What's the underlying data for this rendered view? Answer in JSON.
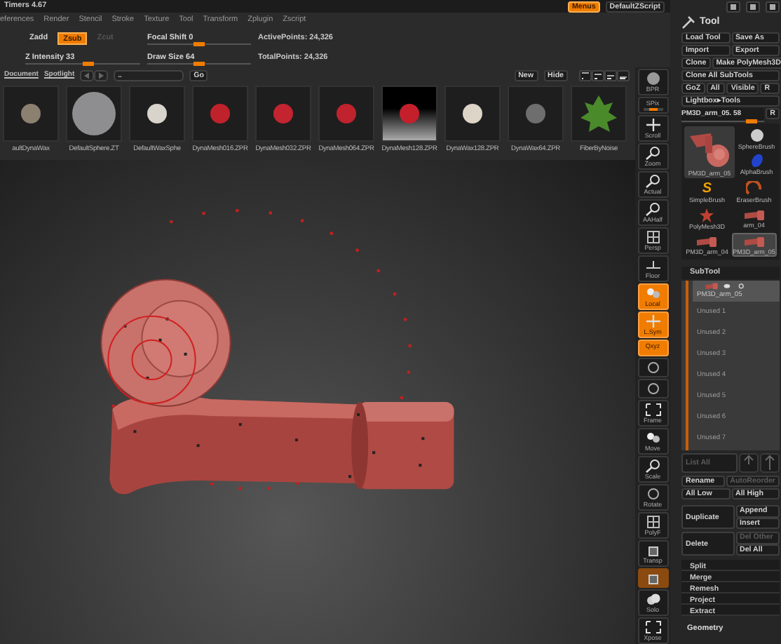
{
  "window": {
    "title": "Timers 4.67"
  },
  "menu": [
    "eferences",
    "Render",
    "Stencil",
    "Stroke",
    "Texture",
    "Tool",
    "Transform",
    "Zplugin",
    "Zscript"
  ],
  "header_buttons": [
    {
      "label": "Menus",
      "on": true
    },
    {
      "label": "DefaultZScript",
      "on": false
    }
  ],
  "shelf": {
    "modes": [
      {
        "label": "Zadd",
        "selected": false,
        "disabled": false
      },
      {
        "label": "Zsub",
        "selected": true,
        "disabled": false
      },
      {
        "label": "Zcut",
        "selected": false,
        "disabled": true
      }
    ],
    "sliders": [
      {
        "label": "Focal Shift 0",
        "level": 0.5
      },
      {
        "label": "Z Intensity 33",
        "level": 0.55
      },
      {
        "label": "Draw Size 64",
        "level": 0.5
      }
    ],
    "stats": [
      "ActivePoints: 24,326",
      "TotalPoints: 24,326"
    ]
  },
  "lightbox": {
    "tabs": [
      "Document",
      "Spotlight"
    ],
    "path": "..",
    "go": "Go",
    "actions": [
      "New",
      "Hide"
    ],
    "items": [
      {
        "label": "aultDynaWax",
        "kind": "sphere",
        "color": "#8c8070"
      },
      {
        "label": "DefaultSphere.ZT",
        "kind": "sphere-large",
        "color": "#8e8e90"
      },
      {
        "label": "DefaultWaxSphe",
        "kind": "sphere",
        "color": "#d8d4cc"
      },
      {
        "label": "DynaMesh016.ZPR",
        "kind": "sphere",
        "color": "#c0222c"
      },
      {
        "label": "DynaMesh032.ZPR",
        "kind": "sphere",
        "color": "#c22430"
      },
      {
        "label": "DynaMesh064.ZPR",
        "kind": "sphere",
        "color": "#c0222e"
      },
      {
        "label": "DynaMesh128.ZPR",
        "kind": "sphere-stage",
        "color": "#c4202c"
      },
      {
        "label": "DynaWax128.ZPR",
        "kind": "sphere",
        "color": "#dcd4c6"
      },
      {
        "label": "DynaWax64.ZPR",
        "kind": "sphere",
        "color": "#6e6e6e"
      },
      {
        "label": "FiberByNoise",
        "kind": "plant",
        "color": "#4a8a2a"
      }
    ]
  },
  "view_toolbar": [
    {
      "label": "BPR",
      "kind": "sphere",
      "on": false
    },
    {
      "label": "SPix",
      "kind": "slider",
      "on": false,
      "level": 0.5
    },
    {
      "label": "Scroll",
      "kind": "arrows",
      "on": false
    },
    {
      "label": "Zoom",
      "kind": "magnifier",
      "on": false
    },
    {
      "label": "Actual",
      "kind": "magnifier",
      "on": false
    },
    {
      "label": "AAHalf",
      "kind": "magnifier",
      "on": false
    },
    {
      "label": "Persp",
      "kind": "grid",
      "on": false
    },
    {
      "label": "Floor",
      "kind": "floor",
      "on": false
    },
    {
      "label": "Local",
      "kind": "dots",
      "on": true
    },
    {
      "label": "L.Sym",
      "kind": "arrows",
      "on": true
    },
    {
      "label": "Qxyz",
      "kind": "text",
      "on": true
    },
    {
      "kind": "ring",
      "on": false
    },
    {
      "kind": "ring",
      "on": false
    },
    {
      "label": "Frame",
      "kind": "frame",
      "on": false
    },
    {
      "label": "Move",
      "kind": "dots",
      "on": false
    },
    {
      "label": "Scale",
      "kind": "magnifier",
      "on": false
    },
    {
      "label": "Rotate",
      "kind": "ring",
      "on": false
    },
    {
      "label": "PolyF",
      "kind": "grid",
      "on": false
    },
    {
      "label": "Transp",
      "kind": "cube",
      "on": false
    },
    {
      "kind": "cube",
      "on": true
    },
    {
      "label": "Solo",
      "kind": "cloud",
      "on": false
    },
    {
      "label": "Xpose",
      "kind": "frame",
      "on": false
    }
  ],
  "tool_panel": {
    "title": "Tool",
    "button_rows": [
      [
        {
          "label": "Load Tool"
        },
        {
          "label": "Save As"
        }
      ],
      [
        {
          "label": "Import"
        },
        {
          "label": "Export"
        }
      ],
      [
        {
          "label": "Clone"
        },
        {
          "label": "Make PolyMesh3D"
        }
      ],
      [
        {
          "label": "Clone All SubTools"
        }
      ],
      [
        {
          "label": "GoZ"
        },
        {
          "label": "All"
        },
        {
          "label": "Visible"
        },
        {
          "label": "R"
        }
      ]
    ],
    "lightbox_tools": "Lightbox▸Tools",
    "current_tool": {
      "label": "PM3D_arm_05. 58",
      "level": 0.85,
      "reset": "R"
    },
    "tools": [
      {
        "label": "SphereBrush",
        "kind": "sphere",
        "selected": false
      },
      {
        "label": "PM3D_arm_05",
        "kind": "arm-large",
        "selected": false
      },
      {
        "label": "AlphaBrush",
        "kind": "alpha",
        "selected": false
      },
      {
        "label": "SimpleBrush",
        "kind": "glyph",
        "glyph": "S",
        "selected": false
      },
      {
        "label": "EraserBrush",
        "kind": "eraser",
        "selected": false
      },
      {
        "label": "PolyMesh3D",
        "kind": "star",
        "selected": false
      },
      {
        "label": "arm_04",
        "kind": "arm",
        "selected": false
      },
      {
        "label": "PM3D_arm_04",
        "kind": "arm",
        "selected": false
      },
      {
        "label": "PM3D_arm_05",
        "kind": "arm",
        "selected": true
      }
    ],
    "subtool": {
      "title": "SubTool",
      "items": [
        {
          "label": "PM3D_arm_05",
          "selected": true,
          "used": true
        },
        {
          "label": "Unused 1",
          "selected": false,
          "used": false
        },
        {
          "label": "Unused 2",
          "selected": false,
          "used": false
        },
        {
          "label": "Unused 3",
          "selected": false,
          "used": false
        },
        {
          "label": "Unused 4",
          "selected": false,
          "used": false
        },
        {
          "label": "Unused 5",
          "selected": false,
          "used": false
        },
        {
          "label": "Unused 6",
          "selected": false,
          "used": false
        },
        {
          "label": "Unused 7",
          "selected": false,
          "used": false
        }
      ],
      "list_all": {
        "label": "List All",
        "disabled": true
      },
      "button_rows": [
        [
          {
            "label": "Rename",
            "disabled": false
          },
          {
            "label": "AutoReorder",
            "disabled": true
          }
        ],
        [
          {
            "label": "All Low",
            "disabled": false
          },
          {
            "label": "All High",
            "disabled": false
          }
        ]
      ],
      "duplicate": {
        "label": "Duplicate",
        "side": [
          {
            "label": "Append",
            "disabled": false
          },
          {
            "label": "Insert",
            "disabled": false
          }
        ]
      },
      "delete": {
        "label": "Delete",
        "side": [
          {
            "label": "Del Other",
            "disabled": true
          },
          {
            "label": "Del All",
            "disabled": false
          }
        ]
      },
      "actions": [
        "Split",
        "Merge",
        "Remesh",
        "Project",
        "Extract"
      ]
    },
    "footer": "Geometry"
  }
}
